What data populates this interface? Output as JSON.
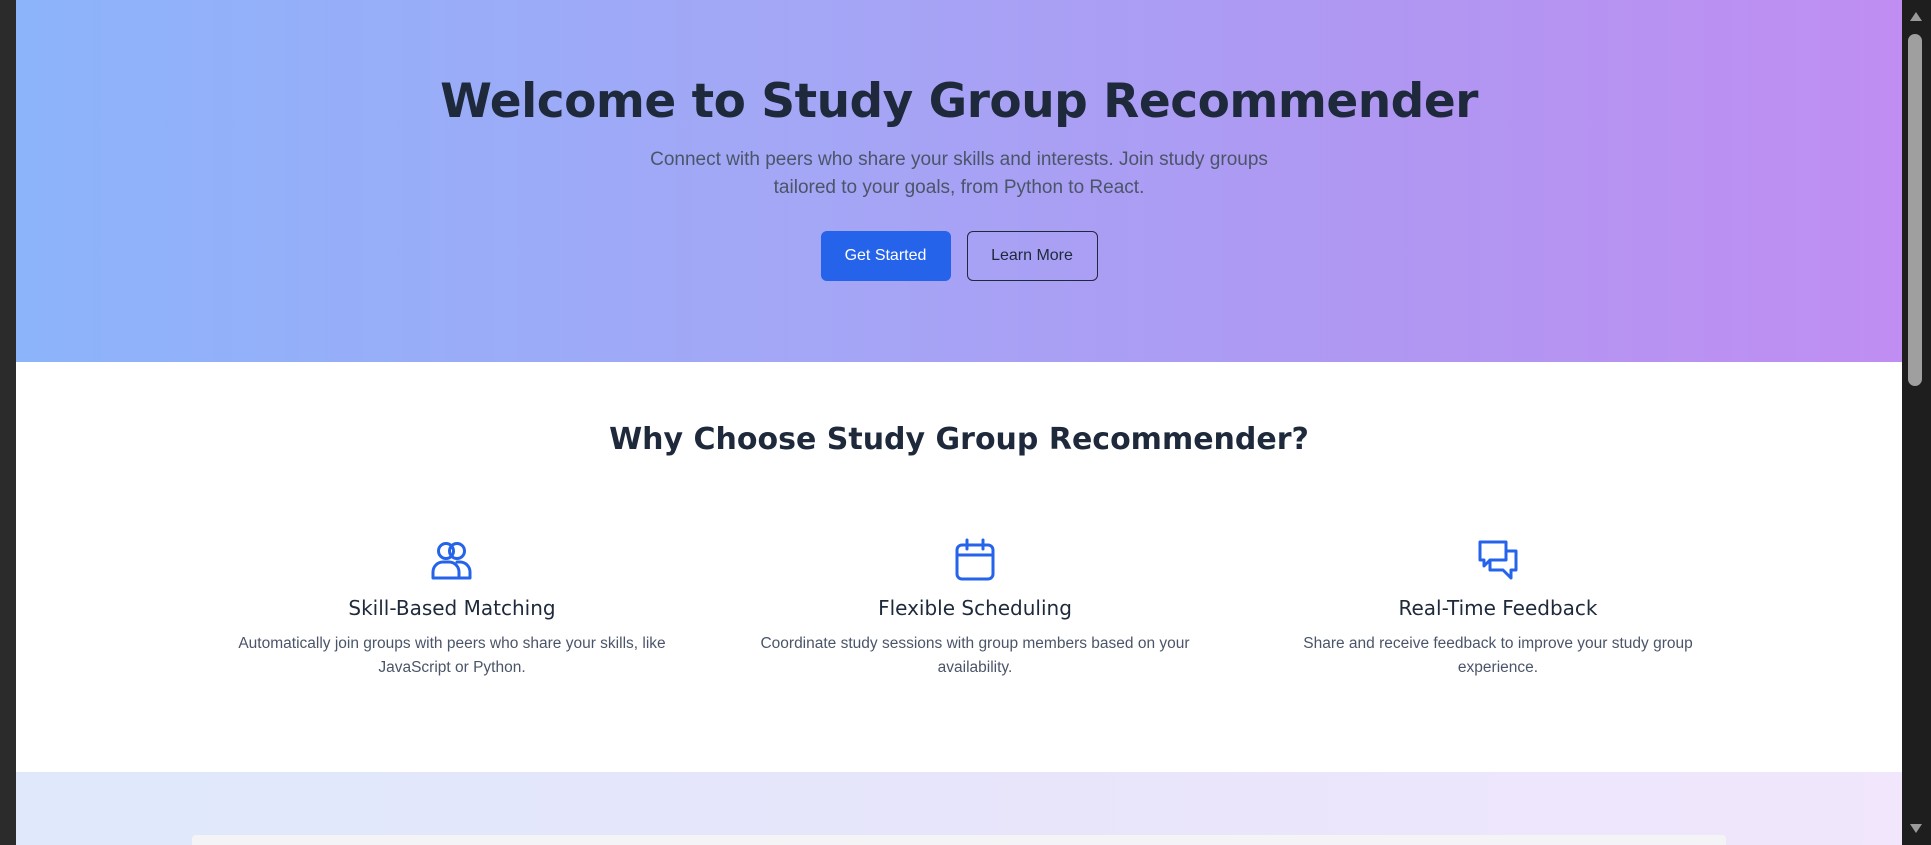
{
  "hero": {
    "title": "Welcome to Study Group Recommender",
    "subtitle": "Connect with peers who share your skills and interests. Join study groups tailored to your goals, from Python to React.",
    "primary_button": "Get Started",
    "secondary_button": "Learn More"
  },
  "features": {
    "heading": "Why Choose Study Group Recommender?",
    "items": [
      {
        "icon": "users-icon",
        "title": "Skill-Based Matching",
        "description": "Automatically join groups with peers who share your skills, like JavaScript or Python."
      },
      {
        "icon": "calendar-icon",
        "title": "Flexible Scheduling",
        "description": "Coordinate study sessions with group members based on your availability."
      },
      {
        "icon": "chat-icon",
        "title": "Real-Time Feedback",
        "description": "Share and receive feedback to improve your study group experience."
      }
    ]
  },
  "colors": {
    "accent": "#2563eb",
    "text_dark": "#1e293b",
    "text_muted": "#4b5569",
    "hero_gradient_start": "#8cb4fb",
    "hero_gradient_end": "#c08ef3"
  }
}
